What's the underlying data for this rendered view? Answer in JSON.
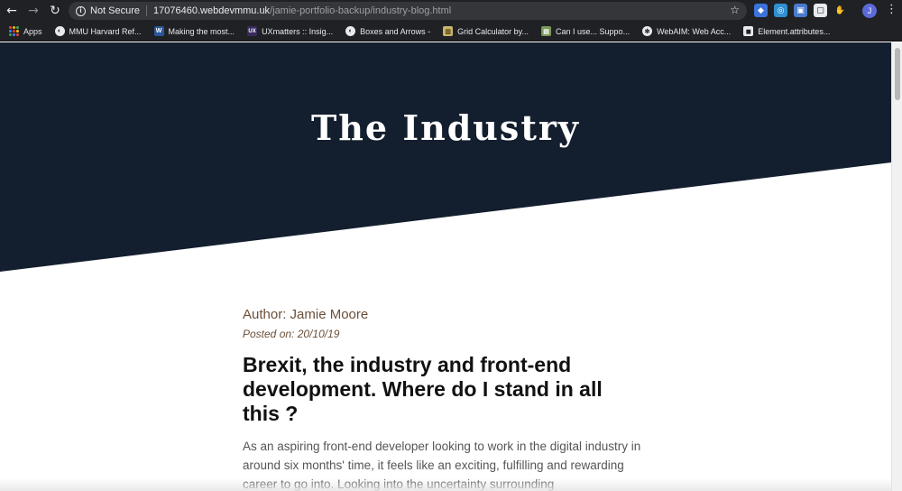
{
  "browser": {
    "security_label": "Not Secure",
    "url_host": "17076460.webdevmmu.uk",
    "url_path": "/jamie-portfolio-backup/industry-blog.html",
    "avatar_initial": "J"
  },
  "bookmarks": [
    {
      "label": "Apps"
    },
    {
      "label": "MMU Harvard Ref..."
    },
    {
      "label": "Making the most..."
    },
    {
      "label": "UXmatters :: Insig..."
    },
    {
      "label": "Boxes and Arrows -"
    },
    {
      "label": "Grid Calculator by..."
    },
    {
      "label": "Can I use... Suppo..."
    },
    {
      "label": "WebAIM: Web Acc..."
    },
    {
      "label": "Element.attributes..."
    }
  ],
  "hero": {
    "title": "The Industry",
    "color": "#131e2e"
  },
  "article": {
    "author": "Author: Jamie Moore",
    "posted": "Posted on: 20/10/19",
    "headline": "Brexit, the industry and front-end development. Where do I stand in all this ?",
    "body": "As an aspiring front-end developer looking to work in the digital industry in around six months' time, it feels like an exciting, fulfilling and rewarding career to go into. Looking into the uncertainty surrounding"
  }
}
